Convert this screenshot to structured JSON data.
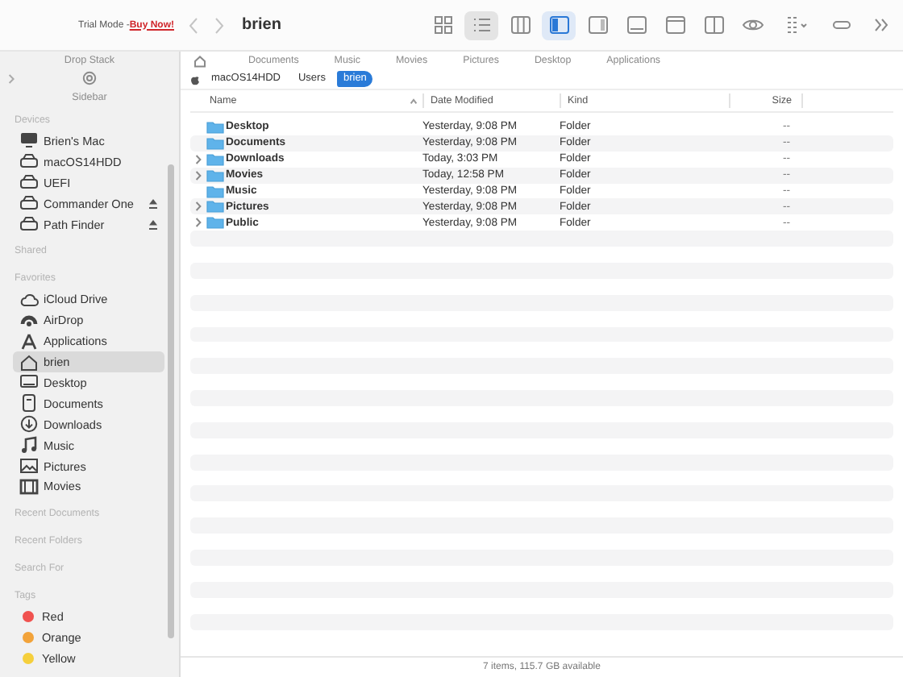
{
  "toolbar": {
    "trial_label": "Trial Mode - ",
    "buy_link": "Buy Now!",
    "title": "brien",
    "buttons": [
      {
        "kind": "icons",
        "selected": false
      },
      {
        "kind": "list",
        "selected": true
      },
      {
        "kind": "columns",
        "selected": false
      },
      {
        "kind": "sidebar-left",
        "selected": true
      },
      {
        "kind": "sidebar-right",
        "selected": false
      },
      {
        "kind": "panel-bottom",
        "selected": false
      },
      {
        "kind": "panel-top",
        "selected": false
      },
      {
        "kind": "split",
        "selected": false
      },
      {
        "kind": "preview",
        "selected": false
      },
      {
        "kind": "group",
        "selected": false
      },
      {
        "kind": "tag",
        "selected": false
      },
      {
        "kind": "more",
        "selected": false
      }
    ]
  },
  "sidebar": {
    "drop_stack": "Drop Stack",
    "label": "Sidebar",
    "sections": [
      {
        "title": "Devices",
        "items": [
          {
            "label": "Brien's Mac",
            "kind": "computer",
            "ejectable": false,
            "selected": false
          },
          {
            "label": "macOS14HDD",
            "kind": "disk",
            "ejectable": false,
            "selected": false
          },
          {
            "label": "UEFI",
            "kind": "disk",
            "ejectable": false,
            "selected": false
          },
          {
            "label": "Commander One",
            "kind": "disk",
            "ejectable": true,
            "selected": false
          },
          {
            "label": "Path Finder",
            "kind": "disk",
            "ejectable": true,
            "selected": false
          }
        ]
      },
      {
        "title": "Shared"
      },
      {
        "title": "Favorites",
        "items": [
          {
            "label": "iCloud Drive",
            "kind": "cloud",
            "selected": false
          },
          {
            "label": "AirDrop",
            "kind": "airdrop",
            "selected": false
          },
          {
            "label": "Applications",
            "kind": "apps",
            "selected": false
          },
          {
            "label": "brien",
            "kind": "home",
            "selected": true
          },
          {
            "label": "Desktop",
            "kind": "desktop",
            "selected": false
          },
          {
            "label": "Documents",
            "kind": "documents",
            "selected": false
          },
          {
            "label": "Downloads",
            "kind": "downloads",
            "selected": false
          },
          {
            "label": "Music",
            "kind": "music",
            "selected": false
          },
          {
            "label": "Pictures",
            "kind": "pictures",
            "selected": false
          },
          {
            "label": "Movies",
            "kind": "movies",
            "selected": false
          }
        ]
      },
      {
        "title": "Recent Documents"
      },
      {
        "title": "Recent Folders"
      },
      {
        "title": "Search For"
      },
      {
        "title": "Tags",
        "items": [
          {
            "label": "Red",
            "kind": "tag",
            "color": "#f0524f",
            "selected": false
          },
          {
            "label": "Orange",
            "kind": "tag",
            "color": "#f2a33a",
            "selected": false
          },
          {
            "label": "Yellow",
            "kind": "tag",
            "color": "#f5cf3c",
            "selected": false
          }
        ]
      }
    ]
  },
  "favorites_bar": [
    "Documents",
    "Music",
    "Movies",
    "Pictures",
    "Desktop",
    "Applications"
  ],
  "path_bar": [
    {
      "label": "macOS14HDD",
      "selected": false
    },
    {
      "label": "Users",
      "selected": false
    },
    {
      "label": "brien",
      "selected": true
    }
  ],
  "table": {
    "columns": [
      {
        "label": "Name",
        "sorted": true
      },
      {
        "label": "Date Modified",
        "sorted": false
      },
      {
        "label": "Kind",
        "sorted": false
      },
      {
        "label": "Size",
        "sorted": false
      }
    ],
    "rows": [
      {
        "name": "Desktop",
        "date": "Yesterday, 9:08 PM",
        "kind": "Folder",
        "size": "--",
        "expandable": false
      },
      {
        "name": "Documents",
        "date": "Yesterday, 9:08 PM",
        "kind": "Folder",
        "size": "--",
        "expandable": false
      },
      {
        "name": "Downloads",
        "date": "Today, 3:03 PM",
        "kind": "Folder",
        "size": "--",
        "expandable": true
      },
      {
        "name": "Movies",
        "date": "Today, 12:58 PM",
        "kind": "Folder",
        "size": "--",
        "expandable": true
      },
      {
        "name": "Music",
        "date": "Yesterday, 9:08 PM",
        "kind": "Folder",
        "size": "--",
        "expandable": false
      },
      {
        "name": "Pictures",
        "date": "Yesterday, 9:08 PM",
        "kind": "Folder",
        "size": "--",
        "expandable": true
      },
      {
        "name": "Public",
        "date": "Yesterday, 9:08 PM",
        "kind": "Folder",
        "size": "--",
        "expandable": true
      }
    ]
  },
  "status_bar": "7 items, 115.7 GB available"
}
